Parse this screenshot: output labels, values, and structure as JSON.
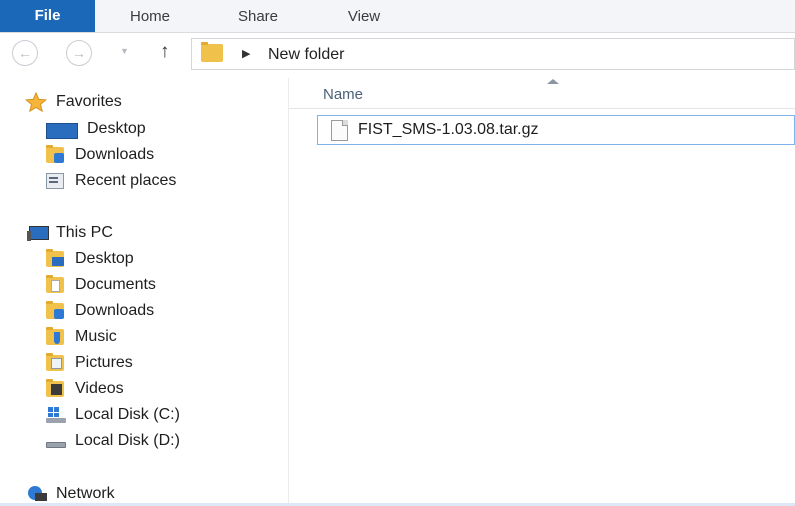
{
  "ribbon": {
    "tabs": [
      {
        "label": "File"
      },
      {
        "label": "Home"
      },
      {
        "label": "Share"
      },
      {
        "label": "View"
      }
    ]
  },
  "address": {
    "path": "New folder",
    "icons": {
      "back": "back-arrow-icon",
      "forward": "forward-arrow-icon",
      "recent": "chevron-down-icon",
      "up": "up-arrow-icon"
    }
  },
  "nav": {
    "favorites": {
      "label": "Favorites",
      "items": [
        {
          "label": "Desktop",
          "icon": "desktop-icon"
        },
        {
          "label": "Downloads",
          "icon": "downloads-folder-icon"
        },
        {
          "label": "Recent places",
          "icon": "recent-places-icon"
        }
      ]
    },
    "this_pc": {
      "label": "This PC",
      "items": [
        {
          "label": "Desktop",
          "icon": "desktop-folder-icon"
        },
        {
          "label": "Documents",
          "icon": "documents-folder-icon"
        },
        {
          "label": "Downloads",
          "icon": "downloads-folder-icon"
        },
        {
          "label": "Music",
          "icon": "music-folder-icon"
        },
        {
          "label": "Pictures",
          "icon": "pictures-folder-icon"
        },
        {
          "label": "Videos",
          "icon": "videos-folder-icon"
        },
        {
          "label": "Local Disk (C:)",
          "icon": "windows-drive-icon"
        },
        {
          "label": "Local Disk (D:)",
          "icon": "drive-icon"
        }
      ]
    },
    "network": {
      "label": "Network"
    }
  },
  "content": {
    "column_name": "Name",
    "files": [
      {
        "name": "FIST_SMS-1.03.08.tar.gz",
        "icon": "file-icon"
      }
    ]
  },
  "colors": {
    "file_tab": "#1b67b8",
    "selection_border": "#7eb4ea",
    "folder": "#f0c24b"
  }
}
